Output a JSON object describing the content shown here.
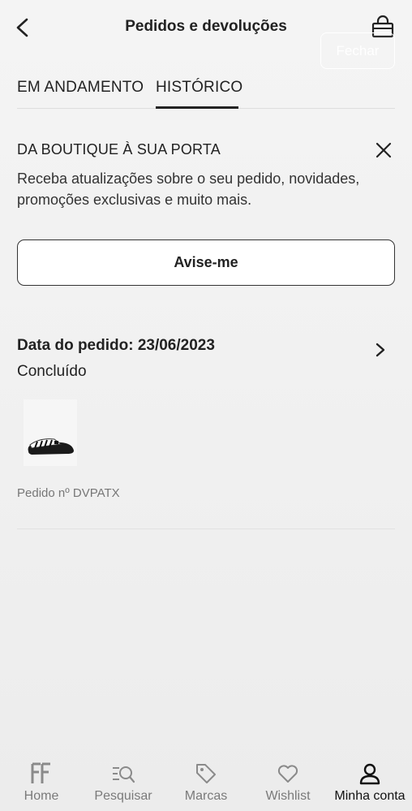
{
  "header": {
    "title": "Pedidos e devoluções",
    "back_icon": "back-arrow-icon",
    "bag_icon": "shopping-bag-icon"
  },
  "overlay": {
    "close_label": "Fechar"
  },
  "tabs": [
    {
      "label": "EM ANDAMENTO",
      "active": false
    },
    {
      "label": "HISTÓRICO",
      "active": true
    }
  ],
  "promo": {
    "title": "DA BOUTIQUE À SUA PORTA",
    "text": "Receba atualizações sobre o seu pedido, novidades, promoções exclusivas e muito mais.",
    "button_label": "Avise-me",
    "close_icon": "close-icon"
  },
  "order": {
    "date_label": "Data do pedido: 23/06/2023",
    "status": "Concluído",
    "order_number": "Pedido nº DVPATX",
    "product_image": "slide-sandal-product-image"
  },
  "bottom_nav": [
    {
      "label": "Home",
      "icon": "home-logo-icon",
      "active": false
    },
    {
      "label": "Pesquisar",
      "icon": "search-icon",
      "active": false
    },
    {
      "label": "Marcas",
      "icon": "tag-icon",
      "active": false
    },
    {
      "label": "Wishlist",
      "icon": "heart-icon",
      "active": false
    },
    {
      "label": "Minha conta",
      "icon": "user-icon",
      "active": true
    }
  ],
  "colors": {
    "text": "#222222",
    "muted": "#777777",
    "nav_inactive": "#7a7a7a",
    "divider": "#dedede",
    "background": "#f2f2f2"
  }
}
